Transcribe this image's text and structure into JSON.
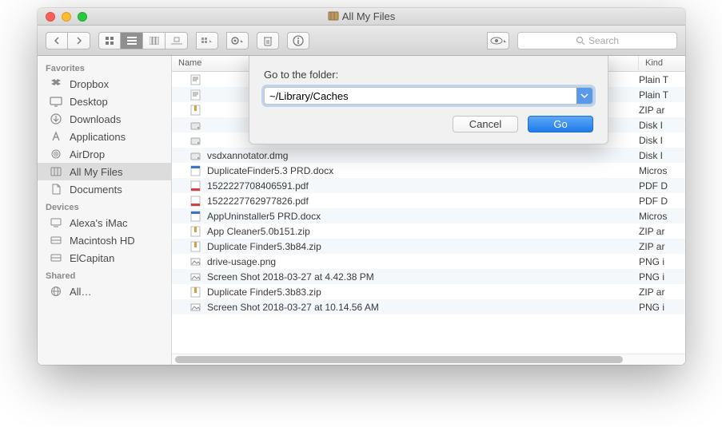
{
  "window": {
    "title": "All My Files"
  },
  "toolbar": {
    "search_placeholder": "Search"
  },
  "sidebar": {
    "sections": [
      {
        "header": "Favorites",
        "items": [
          {
            "id": "dropbox",
            "label": "Dropbox",
            "icon": "dropbox-icon"
          },
          {
            "id": "desktop",
            "label": "Desktop",
            "icon": "desktop-icon"
          },
          {
            "id": "downloads",
            "label": "Downloads",
            "icon": "downloads-icon"
          },
          {
            "id": "applications",
            "label": "Applications",
            "icon": "applications-icon"
          },
          {
            "id": "airdrop",
            "label": "AirDrop",
            "icon": "airdrop-icon"
          },
          {
            "id": "allmyfiles",
            "label": "All My Files",
            "icon": "allfiles-icon",
            "selected": true
          },
          {
            "id": "documents",
            "label": "Documents",
            "icon": "documents-icon"
          }
        ]
      },
      {
        "header": "Devices",
        "items": [
          {
            "id": "alexas-imac",
            "label": "Alexa's iMac",
            "icon": "computer-icon"
          },
          {
            "id": "mac-hd",
            "label": "Macintosh HD",
            "icon": "disk-icon"
          },
          {
            "id": "elcapitan",
            "label": "ElCapitan",
            "icon": "disk-icon"
          }
        ]
      },
      {
        "header": "Shared",
        "items": [
          {
            "id": "all-shared",
            "label": "All…",
            "icon": "globe-icon"
          }
        ]
      }
    ]
  },
  "columns": {
    "name": "Name",
    "kind": "Kind"
  },
  "files": [
    {
      "name": "",
      "kind": "Plain T",
      "icon": "txt"
    },
    {
      "name": "",
      "kind": "Plain T",
      "icon": "txt"
    },
    {
      "name": "",
      "kind": "ZIP ar",
      "icon": "zip"
    },
    {
      "name": "",
      "kind": "Disk I",
      "icon": "dmg"
    },
    {
      "name": "",
      "kind": "Disk I",
      "icon": "dmg"
    },
    {
      "name": "vsdxannotator.dmg",
      "kind": "Disk I",
      "icon": "dmg"
    },
    {
      "name": "DuplicateFinder5.3 PRD.docx",
      "kind": "Micros",
      "icon": "doc"
    },
    {
      "name": "1522227708406591.pdf",
      "kind": "PDF D",
      "icon": "pdf"
    },
    {
      "name": "1522227762977826.pdf",
      "kind": "PDF D",
      "icon": "pdf"
    },
    {
      "name": "AppUninstaller5 PRD.docx",
      "kind": "Micros",
      "icon": "doc"
    },
    {
      "name": "App Cleaner5.0b151.zip",
      "kind": "ZIP ar",
      "icon": "zip"
    },
    {
      "name": "Duplicate Finder5.3b84.zip",
      "kind": "ZIP ar",
      "icon": "zip"
    },
    {
      "name": "drive-usage.png",
      "kind": "PNG i",
      "icon": "png"
    },
    {
      "name": "Screen Shot 2018-03-27 at 4.42.38 PM",
      "kind": "PNG i",
      "icon": "png"
    },
    {
      "name": "Duplicate Finder5.3b83.zip",
      "kind": "ZIP ar",
      "icon": "zip"
    },
    {
      "name": "Screen Shot 2018-03-27 at 10.14.56 AM",
      "kind": "PNG i",
      "icon": "png"
    }
  ],
  "dialog": {
    "label": "Go to the folder:",
    "value": "~/Library/Caches",
    "cancel": "Cancel",
    "go": "Go"
  },
  "icons": {
    "dropbox": "⬧",
    "desktop": "🖥",
    "downloads": "⬇",
    "applications": "Ⓐ",
    "airdrop": "◎",
    "allfiles": "📚",
    "documents": "📄",
    "computer": "🖥",
    "disk": "⛁",
    "globe": "🌐"
  }
}
